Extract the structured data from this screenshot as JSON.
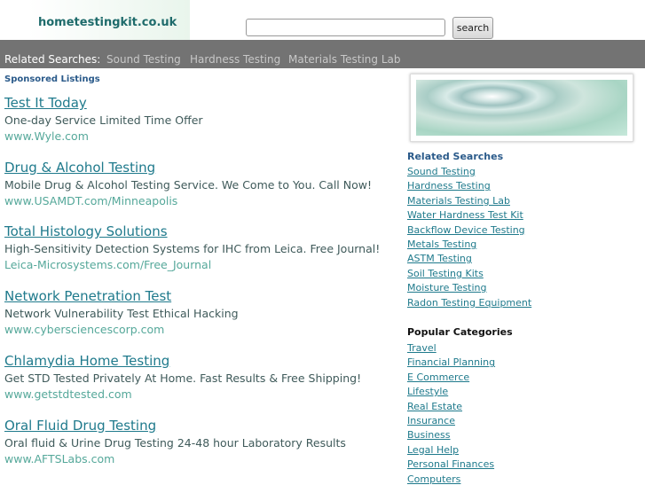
{
  "header": {
    "logo": "hometestingkit.co.uk",
    "search_placeholder": "",
    "search_label": "search"
  },
  "related_bar": {
    "label": "Related Searches:",
    "items": [
      "Sound Testing",
      "Hardness Testing",
      "Materials Testing Lab"
    ]
  },
  "sponsored_heading": "Sponsored Listings",
  "ads": [
    {
      "title": "Test It Today",
      "desc": "One-day Service Limited Time Offer",
      "url": "www.Wyle.com"
    },
    {
      "title": "Drug & Alcohol Testing",
      "desc": "Mobile Drug & Alcohol Testing Service. We Come to You. Call Now!",
      "url": "www.USAMDT.com/Minneapolis"
    },
    {
      "title": "Total Histology Solutions",
      "desc": "High-Sensitivity Detection Systems for IHC from Leica. Free Journal!",
      "url": "Leica-Microsystems.com/Free_Journal"
    },
    {
      "title": "Network Penetration Test",
      "desc": "Network Vulnerability Test Ethical Hacking",
      "url": "www.cybersciencescorp.com"
    },
    {
      "title": "Chlamydia Home Testing",
      "desc": "Get STD Tested Privately At Home. Fast Results & Free Shipping!",
      "url": "www.getstdtested.com"
    },
    {
      "title": "Oral Fluid Drug Testing",
      "desc": "Oral fluid & Urine Drug Testing 24-48 hour Laboratory Results",
      "url": "www.AFTSLabs.com"
    }
  ],
  "sidebar": {
    "related_heading": "Related Searches",
    "related": [
      "Sound Testing",
      "Hardness Testing",
      "Materials Testing Lab",
      "Water Hardness Test Kit",
      "Backflow Device Testing",
      "Metals Testing",
      "ASTM Testing",
      "Soil Testing Kits",
      "Moisture Testing",
      "Radon Testing Equipment"
    ],
    "popular_heading": "Popular Categories",
    "popular": [
      "Travel",
      "Financial Planning",
      "E Commerce",
      "Lifestyle",
      "Real Estate",
      "Insurance",
      "Business",
      "Legal Help",
      "Personal Finances",
      "Computers"
    ]
  }
}
